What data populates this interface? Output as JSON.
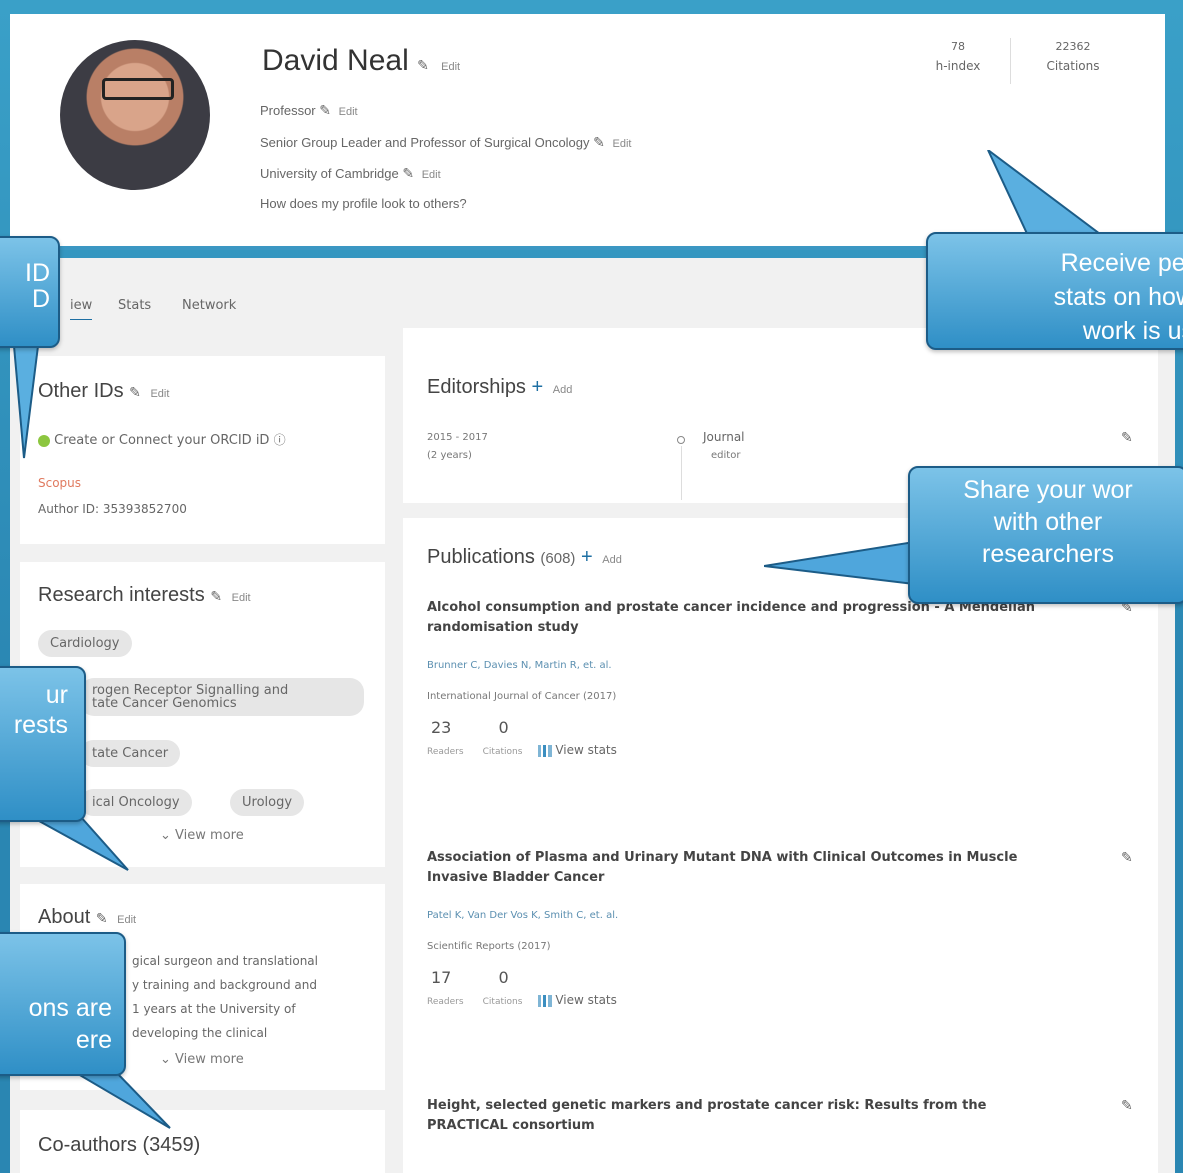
{
  "profile": {
    "name": "David Neal",
    "edit_label": "Edit",
    "title": "Professor",
    "role": "Senior Group Leader and Professor of Surgical Oncology",
    "institution": "University of Cambridge",
    "preview_link": "How does my profile look to others?",
    "h_index_value": "78",
    "h_index_label": "h-index",
    "citations_value": "22362",
    "citations_label": "Citations"
  },
  "tabs": [
    {
      "label": "iew"
    },
    {
      "label": "Stats"
    },
    {
      "label": "Network"
    }
  ],
  "other_ids": {
    "heading": "Other IDs",
    "edit_label": "Edit",
    "orcid_link": "Create or Connect your ORCID iD",
    "scopus_label": "Scopus",
    "author_id": "Author ID: 35393852700"
  },
  "research": {
    "heading": "Research interests",
    "edit_label": "Edit",
    "chips": [
      {
        "label": "Cardiology"
      },
      {
        "label": "rogen Receptor Signalling and\ntate Cancer Genomics"
      },
      {
        "label": "tate Cancer"
      },
      {
        "label": "ical Oncology"
      },
      {
        "label": "Urology"
      }
    ],
    "view_more": "View more"
  },
  "about": {
    "heading": "About",
    "edit_label": "Edit",
    "lines": [
      "gical surgeon and translational",
      "y training and background and",
      "1 years at the University of",
      "developing the clinical"
    ],
    "view_more": "View more"
  },
  "coauthors": {
    "heading": "Co-authors (3459)"
  },
  "editorships": {
    "heading": "Editorships",
    "add_label": "Add",
    "years": "2015 - 2017",
    "duration": "(2 years)",
    "journal": "Journal",
    "role": "editor"
  },
  "publications": {
    "heading": "Publications",
    "count": "(608)",
    "add_label": "Add",
    "items": [
      {
        "title1": "Alcohol consumption and prostate cancer incidence and progression - A Mendelian",
        "title2": "randomisation study",
        "authors": "Brunner C, Davies N, Martin R, et. al.",
        "source": "International Journal of Cancer (2017)",
        "readers": "23",
        "citations": "0",
        "readers_label": "Readers",
        "citations_label": "Citations",
        "view_stats": "View stats"
      },
      {
        "title1": "Association of Plasma and Urinary Mutant DNA with Clinical Outcomes in Muscle",
        "title2": "Invasive Bladder Cancer",
        "authors": "Patel K, Van Der Vos K, Smith C, et. al.",
        "source": "Scientific Reports (2017)",
        "readers": "17",
        "citations": "0",
        "readers_label": "Readers",
        "citations_label": "Citations",
        "view_stats": "View stats"
      },
      {
        "title1": "Height, selected genetic markers and prostate cancer risk: Results from the",
        "title2": "PRACTICAL consortium"
      }
    ]
  },
  "callouts": {
    "stats": [
      "Receive per",
      "stats on how",
      "work is us"
    ],
    "share": [
      "Share your wor",
      "with other",
      "researchers"
    ],
    "orcid": [
      "ID",
      "D"
    ],
    "interests": [
      "ur",
      "rests"
    ],
    "about": [
      "ons are",
      "ere"
    ]
  },
  "colors": {
    "accent": "#2a86b2",
    "bubble": "#3b97cf"
  }
}
